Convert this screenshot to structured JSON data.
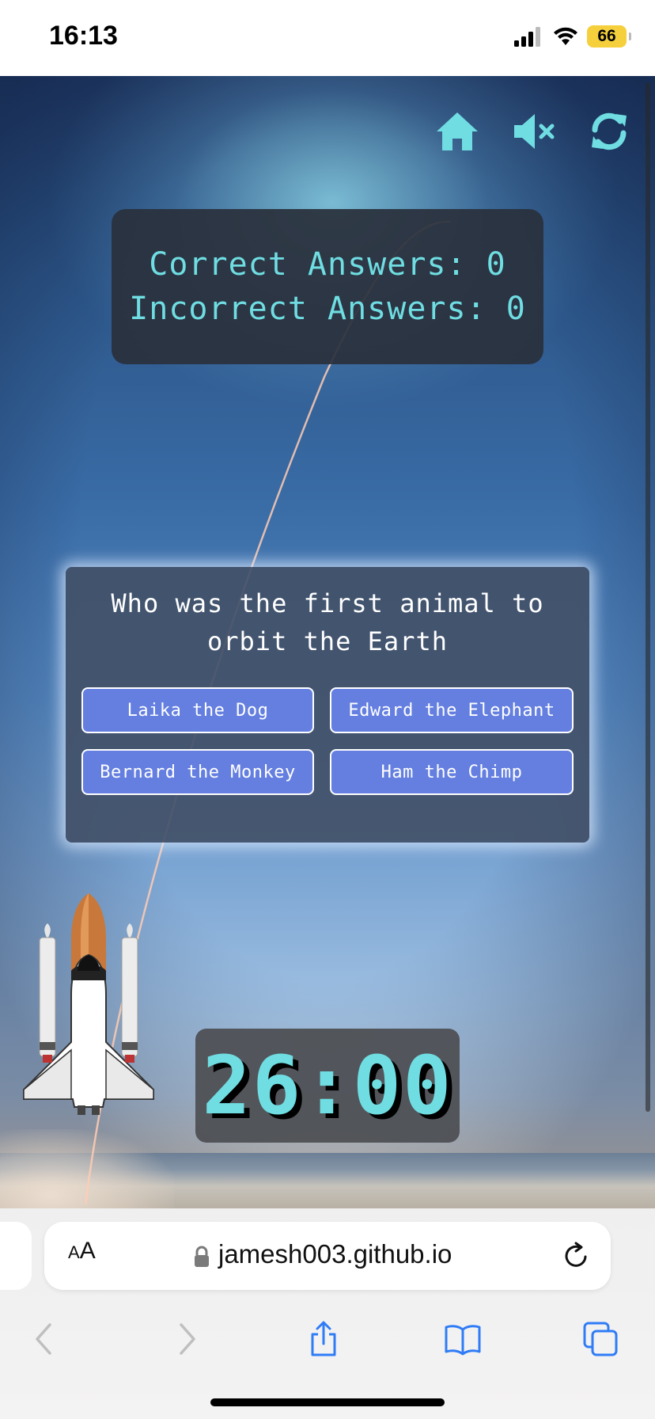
{
  "status_bar": {
    "time": "16:13",
    "battery": "66"
  },
  "controls": {
    "home_icon": "home-icon",
    "mute_icon": "speaker-muted-icon",
    "restart_icon": "refresh-icon",
    "accent_color": "#6fdde2"
  },
  "score": {
    "correct_line": "Correct Answers: 0",
    "incorrect_line": "Incorrect Answers: 0"
  },
  "question": {
    "text": "Who was the first animal to orbit the Earth",
    "answers": [
      "Laika the Dog",
      "Edward the Elephant",
      "Bernard the Monkey",
      "Ham the Chimp"
    ],
    "button_color": "#647fe0"
  },
  "timer": {
    "value": "26:00"
  },
  "browser": {
    "text_size_small": "A",
    "text_size_large": "A",
    "url": "jamesh003.github.io"
  }
}
